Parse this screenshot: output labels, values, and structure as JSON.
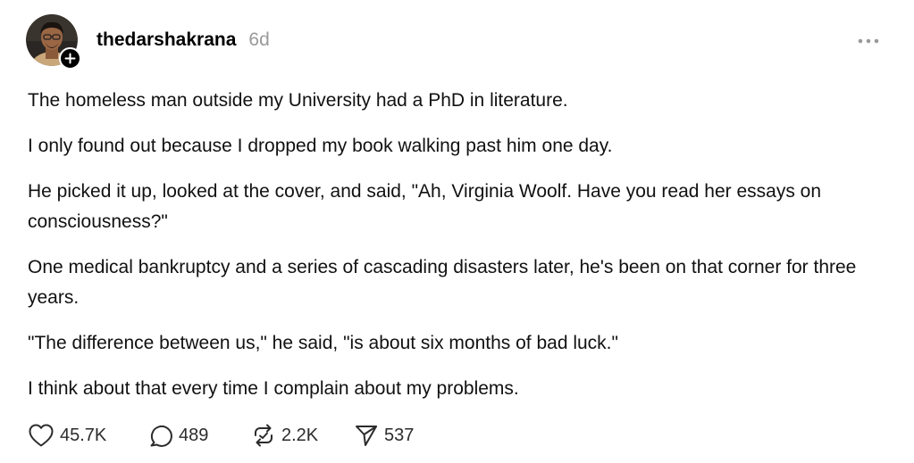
{
  "post": {
    "username": "thedarshakrana",
    "timestamp": "6d",
    "paragraphs": [
      "The homeless man outside my University had a PhD in literature.",
      "I only found out because I dropped my book walking past him one day.",
      "He picked it up, looked at the cover, and said, \"Ah, Virginia Woolf. Have you read her essays on consciousness?\"",
      "One medical bankruptcy and a series of cascading disasters later, he's been on that corner for three years.",
      "\"The difference between us,\" he said, \"is about six months of bad luck.\"",
      "I think about that every time I complain about my problems."
    ],
    "actions": {
      "likes": "45.7K",
      "replies": "489",
      "reposts": "2.2K",
      "shares": "537"
    }
  },
  "icons": {
    "avatar": "profile-photo",
    "follow": "plus-icon",
    "more": "ellipsis-icon",
    "like": "heart-icon",
    "reply": "comment-bubble-icon",
    "repost": "repost-icon",
    "share": "send-icon"
  },
  "colors": {
    "text": "#111111",
    "muted": "#9a9a9a",
    "background": "#ffffff"
  }
}
